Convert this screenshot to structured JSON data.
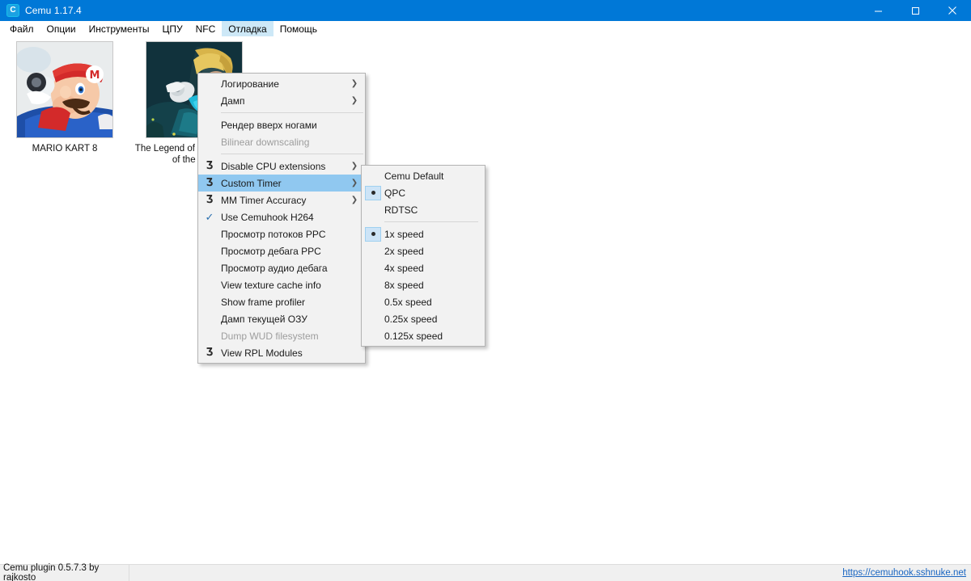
{
  "window": {
    "title": "Cemu 1.17.4",
    "logo_letter": "C",
    "logo_icon": "cemu-logo-icon",
    "controls": {
      "minimize": "minimize-icon",
      "maximize": "maximize-icon",
      "close": "close-icon"
    }
  },
  "menubar": {
    "items": [
      {
        "label": "Файл",
        "active": false
      },
      {
        "label": "Опции",
        "active": false
      },
      {
        "label": "Инструменты",
        "active": false
      },
      {
        "label": "ЦПУ",
        "active": false
      },
      {
        "label": "NFC",
        "active": false
      },
      {
        "label": "Отладка",
        "active": true
      },
      {
        "label": "Помощь",
        "active": false
      }
    ]
  },
  "games": [
    {
      "title": "MARIO KART 8"
    },
    {
      "title": "The Legend of Zelda: Breath of the Wild"
    }
  ],
  "debug_menu": {
    "items": [
      {
        "label": "Логирование",
        "icon": "",
        "arrow": true,
        "disabled": false,
        "highlight": false,
        "sep_after": false
      },
      {
        "label": "Дамп",
        "icon": "",
        "arrow": true,
        "disabled": false,
        "highlight": false,
        "sep_after": true
      },
      {
        "label": "Рендер вверх ногами",
        "icon": "",
        "arrow": false,
        "disabled": false,
        "highlight": false,
        "sep_after": false
      },
      {
        "label": "Bilinear downscaling",
        "icon": "",
        "arrow": false,
        "disabled": true,
        "highlight": false,
        "sep_after": true
      },
      {
        "label": "Disable CPU extensions",
        "icon": "hook-icon",
        "arrow": true,
        "disabled": false,
        "highlight": false,
        "sep_after": false
      },
      {
        "label": "Custom Timer",
        "icon": "hook-icon",
        "arrow": true,
        "disabled": false,
        "highlight": true,
        "sep_after": false
      },
      {
        "label": "MM Timer Accuracy",
        "icon": "hook-icon",
        "arrow": true,
        "disabled": false,
        "highlight": false,
        "sep_after": false
      },
      {
        "label": "Use Cemuhook H264",
        "icon": "check-icon",
        "arrow": false,
        "disabled": false,
        "highlight": false,
        "sep_after": false
      },
      {
        "label": "Просмотр потоков PPC",
        "icon": "",
        "arrow": false,
        "disabled": false,
        "highlight": false,
        "sep_after": false
      },
      {
        "label": "Просмотр дебага PPC",
        "icon": "",
        "arrow": false,
        "disabled": false,
        "highlight": false,
        "sep_after": false
      },
      {
        "label": "Просмотр аудио дебага",
        "icon": "",
        "arrow": false,
        "disabled": false,
        "highlight": false,
        "sep_after": false
      },
      {
        "label": "View texture cache info",
        "icon": "",
        "arrow": false,
        "disabled": false,
        "highlight": false,
        "sep_after": false
      },
      {
        "label": "Show frame profiler",
        "icon": "",
        "arrow": false,
        "disabled": false,
        "highlight": false,
        "sep_after": false
      },
      {
        "label": "Дамп текущей ОЗУ",
        "icon": "",
        "arrow": false,
        "disabled": false,
        "highlight": false,
        "sep_after": false
      },
      {
        "label": "Dump WUD filesystem",
        "icon": "",
        "arrow": false,
        "disabled": true,
        "highlight": false,
        "sep_after": false
      },
      {
        "label": "View RPL Modules",
        "icon": "hook-icon",
        "arrow": false,
        "disabled": false,
        "highlight": false,
        "sep_after": false
      }
    ]
  },
  "timer_submenu": {
    "items": [
      {
        "label": "Cemu Default",
        "selected": false,
        "sep_after": false
      },
      {
        "label": "QPC",
        "selected": true,
        "sep_after": false
      },
      {
        "label": "RDTSC",
        "selected": false,
        "sep_after": true
      },
      {
        "label": "1x speed",
        "selected": true,
        "sep_after": false
      },
      {
        "label": "2x speed",
        "selected": false,
        "sep_after": false
      },
      {
        "label": "4x speed",
        "selected": false,
        "sep_after": false
      },
      {
        "label": "8x speed",
        "selected": false,
        "sep_after": false
      },
      {
        "label": "0.5x speed",
        "selected": false,
        "sep_after": false
      },
      {
        "label": "0.25x speed",
        "selected": false,
        "sep_after": false
      },
      {
        "label": "0.125x speed",
        "selected": false,
        "sep_after": false
      }
    ]
  },
  "statusbar": {
    "plugin_text": "Cemu plugin 0.5.7.3 by rajkosto",
    "link_text": "https://cemuhook.sshnuke.net"
  },
  "colors": {
    "titlebar": "#0078d7",
    "menu_highlight": "#90c8f0",
    "menubar_active": "#cde8f7",
    "menu_bg": "#f2f2f2",
    "link": "#1a66c2"
  }
}
